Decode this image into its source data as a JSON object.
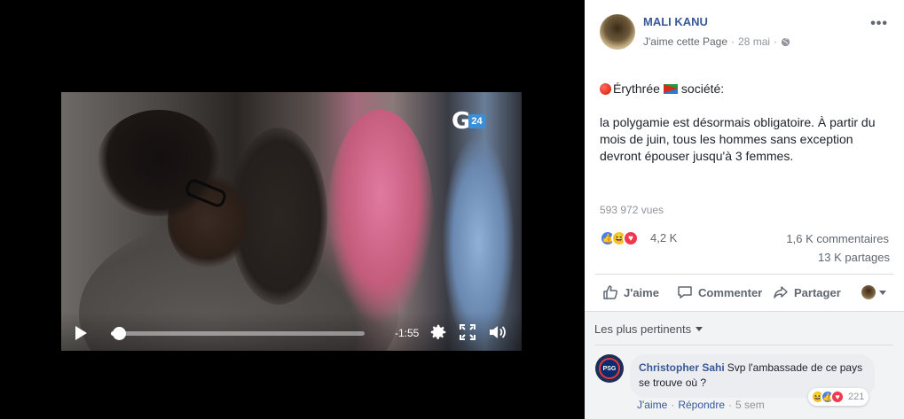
{
  "video": {
    "channel_logo": "G",
    "channel_badge": "24",
    "time_remaining": "-1:55",
    "progress_fraction": 0.03
  },
  "post": {
    "page_name": "MALI KANU",
    "like_page": "J'aime cette Page",
    "date": "28 mai",
    "separator": "·",
    "headline": "Érythrée",
    "headline_suffix": "société:",
    "body": "la polygamie est désormais obligatoire. À partir du mois de juin, tous les hommes sans exception devront épouser jusqu'à 3 femmes.",
    "views": "593 972 vues",
    "reaction_count": "4,2 K",
    "comments_count": "1,6 K commentaires",
    "shares_count": "13 K partages",
    "icons": [
      "globe-icon",
      "more-icon",
      "like-reaction",
      "haha-reaction",
      "love-reaction"
    ]
  },
  "actions": {
    "like": "J'aime",
    "comment": "Commenter",
    "share": "Partager"
  },
  "comments": {
    "sort_label": "Les plus pertinents",
    "items": [
      {
        "author": "Christopher Sahi",
        "text": "Svp l'ambassade de ce pays se trouve où ?",
        "reaction_count": "221",
        "like_label": "J'aime",
        "reply_label": "Répondre",
        "age": "5 sem"
      }
    ]
  },
  "colors": {
    "link_blue": "#385898",
    "muted_text": "#90949c",
    "like_blue": "#4a7ee8",
    "love_red": "#f0384f",
    "haha_yellow": "#f7c637"
  }
}
